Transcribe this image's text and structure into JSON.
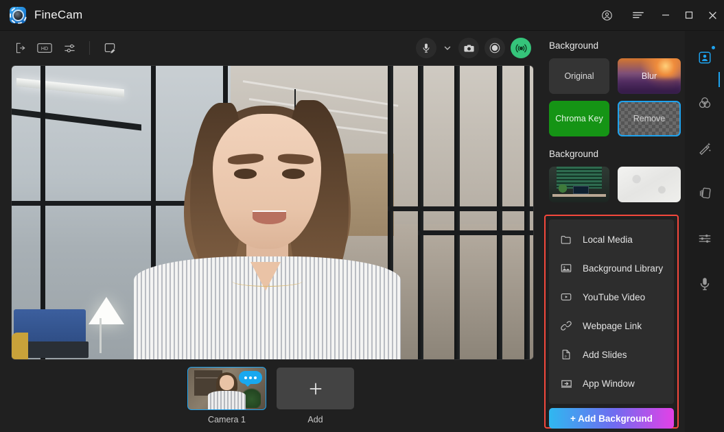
{
  "window": {
    "app_title": "FineCam",
    "logo_icon": "finecam-logo",
    "controls": [
      {
        "name": "account-button",
        "icon": "account-circle-icon"
      },
      {
        "name": "menu-button",
        "icon": "hamburger-menu-icon"
      },
      {
        "name": "minimize-button",
        "icon": "minimize-icon"
      },
      {
        "name": "maximize-button",
        "icon": "maximize-icon"
      },
      {
        "name": "close-button",
        "icon": "close-icon"
      }
    ]
  },
  "toolbar": {
    "left": [
      {
        "name": "exit-button",
        "icon": "exit-door-icon"
      },
      {
        "name": "hd-quality-button",
        "icon": "hd-badge-icon",
        "label": "HD"
      },
      {
        "name": "adjust-settings-button",
        "icon": "sliders-icon"
      },
      {
        "name": "annotate-button",
        "icon": "whiteboard-pen-icon"
      }
    ],
    "center": [
      {
        "name": "microphone-button",
        "icon": "microphone-icon"
      },
      {
        "name": "microphone-dropdown",
        "icon": "chevron-down-icon"
      },
      {
        "name": "snapshot-button",
        "icon": "camera-icon"
      },
      {
        "name": "record-button",
        "icon": "record-circle-icon"
      },
      {
        "name": "live-broadcast-button",
        "icon": "broadcast-waves-icon"
      }
    ]
  },
  "stage": {
    "scene_description": "Woman in striped blouse on video with modern office corridor background"
  },
  "camera_strip": {
    "cameras": [
      {
        "label": "Camera 1",
        "selected": true,
        "badge_icon": "speech-bubble-dots-icon"
      }
    ],
    "add_label": "Add",
    "add_icon": "plus-icon"
  },
  "background_panel": {
    "mode_section_title": "Background",
    "modes": [
      {
        "label": "Original",
        "name": "background-mode-original",
        "selected": false
      },
      {
        "label": "Blur",
        "name": "background-mode-blur",
        "selected": false
      },
      {
        "label": "Chroma Key",
        "name": "background-mode-chroma-key",
        "selected": false
      },
      {
        "label": "Remove",
        "name": "background-mode-remove",
        "selected": true
      }
    ],
    "library_section_title": "Background",
    "thumbnails": [
      {
        "name": "background-thumbnail-office",
        "description": "Office desk with green window blinds"
      },
      {
        "name": "background-thumbnail-marble",
        "description": "White textured marble surface"
      }
    ]
  },
  "menu": {
    "items": [
      {
        "label": "Local Media",
        "icon": "folder-icon",
        "name": "menu-item-local-media"
      },
      {
        "label": "Background Library",
        "icon": "image-icon",
        "name": "menu-item-background-library"
      },
      {
        "label": "YouTube Video",
        "icon": "play-rectangle-icon",
        "name": "menu-item-youtube-video"
      },
      {
        "label": "Webpage Link",
        "icon": "link-chain-icon",
        "name": "menu-item-webpage-link"
      },
      {
        "label": "Add Slides",
        "icon": "powerpoint-file-icon",
        "name": "menu-item-add-slides"
      },
      {
        "label": "App Window",
        "icon": "app-window-arrow-icon",
        "name": "menu-item-app-window"
      }
    ],
    "add_background_label": "+ Add Background",
    "highlight_color": "#f5483c"
  },
  "rail": {
    "items": [
      {
        "name": "rail-background-tab",
        "icon": "person-portrait-icon",
        "active": true,
        "has_dot": true
      },
      {
        "name": "rail-color-tab",
        "icon": "color-circles-icon",
        "active": false
      },
      {
        "name": "rail-beautify-tab",
        "icon": "magic-wand-icon",
        "active": false
      },
      {
        "name": "rail-layers-tab",
        "icon": "layers-cards-icon",
        "active": false
      },
      {
        "name": "rail-adjust-tab",
        "icon": "sliders-horizontal-icon",
        "active": false
      },
      {
        "name": "rail-audio-tab",
        "icon": "microphone-icon",
        "active": false
      }
    ]
  },
  "colors": {
    "accent_blue": "#1ea3ef",
    "chroma_green": "#159415",
    "live_green": "#35c47a",
    "highlight_red": "#f5483c",
    "gradient_start": "#2fb8f0",
    "gradient_end": "#e341e6"
  }
}
